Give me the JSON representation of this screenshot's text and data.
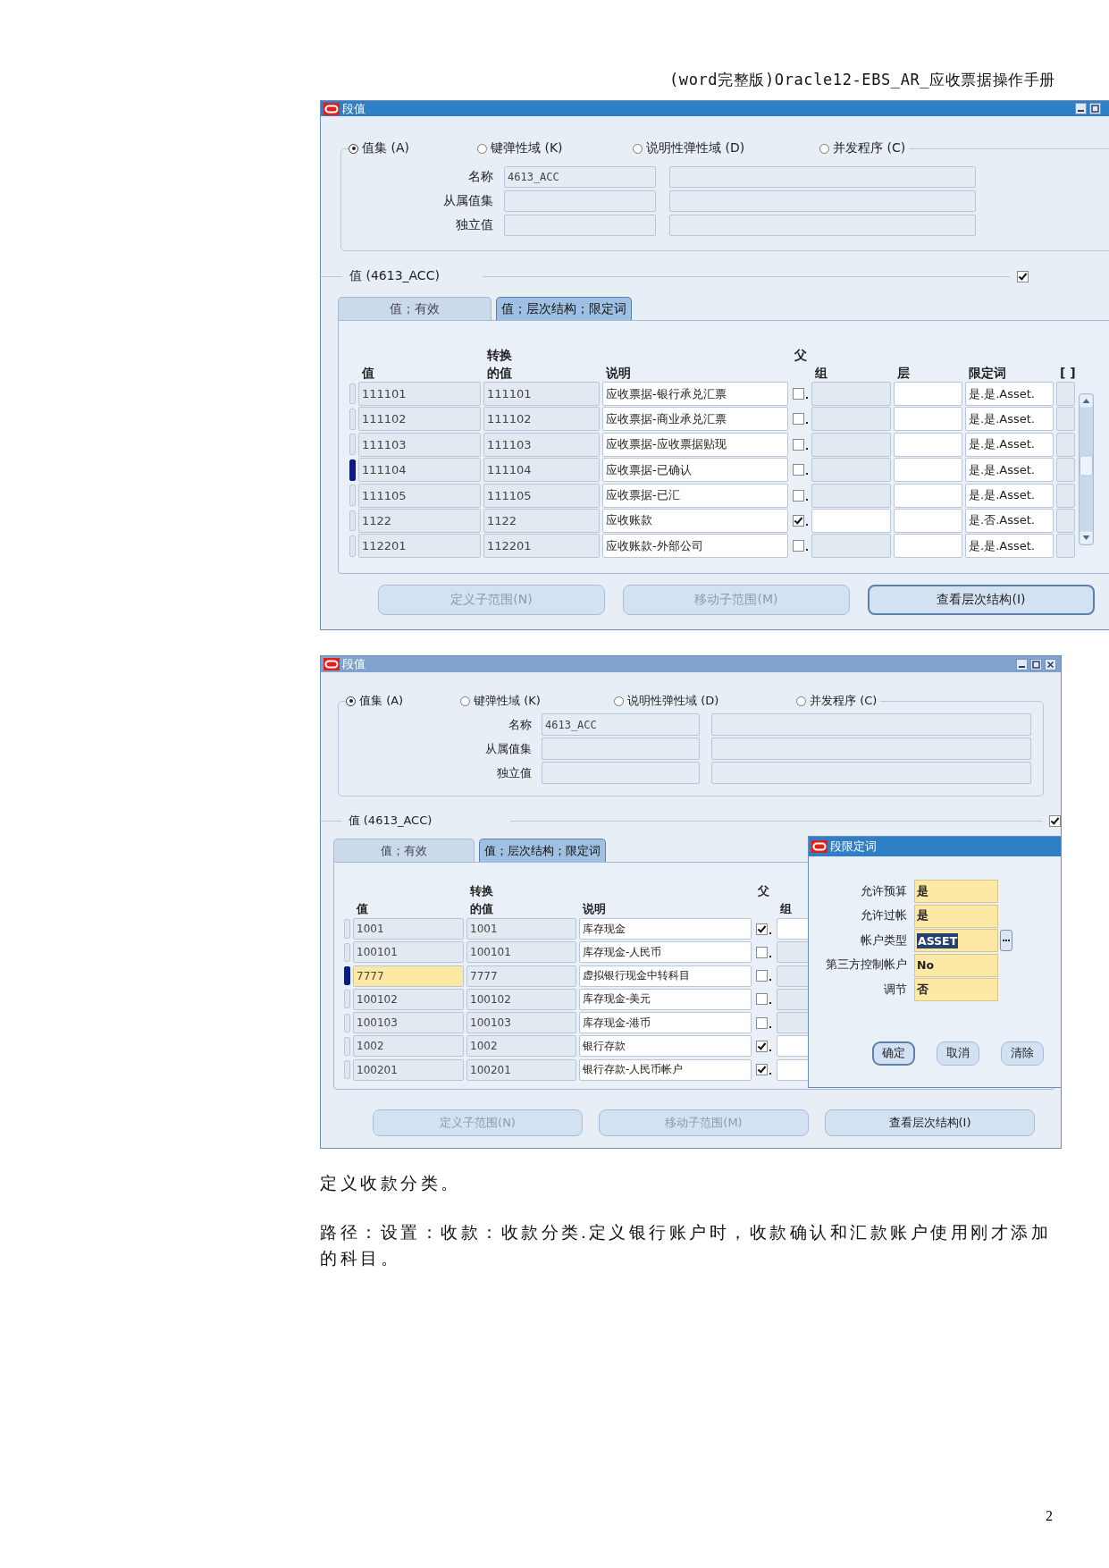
{
  "header": "(word完整版)Oracle12-EBS_AR_应收票据操作手册",
  "windows": [
    {
      "title": "段值",
      "active": true,
      "window_buttons": [
        {
          "kind": "minimize"
        },
        {
          "kind": "maximize"
        }
      ],
      "radios": [
        {
          "label": "值集 (A)",
          "selected": true
        },
        {
          "label": "键弹性域 (K)",
          "selected": false
        },
        {
          "label": "说明性弹性域 (D)",
          "selected": false
        },
        {
          "label": "并发程序 (C)",
          "selected": false
        }
      ],
      "fields": [
        {
          "label": "名称",
          "value": "4613_ACC"
        },
        {
          "label": "从属值集"
        },
        {
          "label": "独立值"
        }
      ],
      "section": {
        "title": "值 (4613_ACC)",
        "checked": true
      },
      "tabs": [
        {
          "label": "值；有效",
          "selected": false
        },
        {
          "label": "值；层次结构；限定词",
          "selected": true
        }
      ],
      "columns": [
        {
          "kind": "value",
          "label": "值"
        },
        {
          "kind": "converted",
          "label_top": "转换",
          "label": "的值"
        },
        {
          "kind": "description",
          "label": "说明"
        },
        {
          "kind": "parent",
          "label_top": "父"
        },
        {
          "kind": "group",
          "label": "组"
        },
        {
          "kind": "level",
          "label": "层"
        },
        {
          "kind": "qualifier",
          "label": "限定词"
        },
        {
          "kind": "extra",
          "label": "[ ]"
        }
      ],
      "scrollbar": true,
      "rows": [
        {
          "value": "111101",
          "converted": "111101",
          "description": "应收票据-银行承兑汇票",
          "parent": false,
          "qualifier": "是.是.Asset.",
          "current": false,
          "focused": false
        },
        {
          "value": "111102",
          "converted": "111102",
          "description": "应收票据-商业承兑汇票",
          "parent": false,
          "qualifier": "是.是.Asset.",
          "current": false,
          "focused": false
        },
        {
          "value": "111103",
          "converted": "111103",
          "description": "应收票据-应收票据贴现",
          "parent": false,
          "qualifier": "是.是.Asset.",
          "current": false,
          "focused": false
        },
        {
          "value": "111104",
          "converted": "111104",
          "description": "应收票据-已确认",
          "parent": false,
          "qualifier": "是.是.Asset.",
          "current": true,
          "focused": false
        },
        {
          "value": "111105",
          "converted": "111105",
          "description": "应收票据-已汇",
          "parent": false,
          "qualifier": "是.是.Asset.",
          "current": false,
          "focused": false
        },
        {
          "value": "1122",
          "converted": "1122",
          "description": "应收账款",
          "parent": true,
          "qualifier": "是.否.Asset.",
          "current": false,
          "focused": false
        },
        {
          "value": "112201",
          "converted": "112201",
          "description": "应收账款-外部公司",
          "parent": false,
          "qualifier": "是.是.Asset.",
          "current": false,
          "focused": false
        }
      ],
      "buttons": [
        {
          "label": "定义子范围(N)",
          "disabled": true
        },
        {
          "label": "移动子范围(M)",
          "disabled": true
        },
        {
          "label": "查看层次结构(I)",
          "disabled": false
        }
      ]
    },
    {
      "title": "段值",
      "active": false,
      "window_buttons": [
        {
          "kind": "minimize"
        },
        {
          "kind": "maximize"
        },
        {
          "kind": "close"
        }
      ],
      "radios": [
        {
          "label": "值集 (A)",
          "selected": true
        },
        {
          "label": "键弹性域 (K)",
          "selected": false
        },
        {
          "label": "说明性弹性域 (D)",
          "selected": false
        },
        {
          "label": "并发程序 (C)",
          "selected": false
        }
      ],
      "fields": [
        {
          "label": "名称",
          "value": "4613_ACC"
        },
        {
          "label": "从属值集"
        },
        {
          "label": "独立值"
        }
      ],
      "section": {
        "title": "值 (4613_ACC)",
        "checked": true
      },
      "tabs": [
        {
          "label": "值；有效",
          "selected": false
        },
        {
          "label": "值；层次结构；限定词",
          "selected": true
        }
      ],
      "columns": [
        {
          "kind": "value",
          "label": "值"
        },
        {
          "kind": "converted",
          "label_top": "转换",
          "label": "的值"
        },
        {
          "kind": "description",
          "label": "说明"
        },
        {
          "kind": "parent",
          "label_top": "父"
        },
        {
          "kind": "group",
          "label": "组"
        }
      ],
      "scrollbar": false,
      "rows": [
        {
          "value": "1001",
          "converted": "1001",
          "description": "库存现金",
          "parent": true,
          "current": false,
          "focused": false
        },
        {
          "value": "100101",
          "converted": "100101",
          "description": "库存现金-人民币",
          "parent": false,
          "current": false,
          "focused": false
        },
        {
          "value": "7777",
          "converted": "7777",
          "description": "虚拟银行现金中转科目",
          "parent": false,
          "current": true,
          "focused": true
        },
        {
          "value": "100102",
          "converted": "100102",
          "description": "库存现金-美元",
          "parent": false,
          "current": false,
          "focused": false
        },
        {
          "value": "100103",
          "converted": "100103",
          "description": "库存现金-港币",
          "parent": false,
          "current": false,
          "focused": false
        },
        {
          "value": "1002",
          "converted": "1002",
          "description": "银行存款",
          "parent": true,
          "current": false,
          "focused": false
        },
        {
          "value": "100201",
          "converted": "100201",
          "description": "银行存款-人民币帐户",
          "parent": true,
          "current": false,
          "focused": false
        }
      ],
      "buttons": [
        {
          "label": "定义子范围(N)",
          "disabled": true
        },
        {
          "label": "移动子范围(M)",
          "disabled": true
        },
        {
          "label": "查看层次结构(I)",
          "disabled": false
        }
      ],
      "popup": {
        "title": "段限定词",
        "fields": [
          {
            "label": "允许预算",
            "value": "是",
            "lov": false,
            "selected": false
          },
          {
            "label": "允许过帐",
            "value": "是",
            "lov": false,
            "selected": false
          },
          {
            "label": "帐户类型",
            "value": "ASSET",
            "lov": true,
            "selected": true
          },
          {
            "label": "第三方控制帐户",
            "value": "No",
            "lov": false,
            "selected": false
          },
          {
            "label": "调节",
            "value": "否",
            "lov": false,
            "selected": false
          }
        ],
        "buttons": [
          {
            "label": "确定",
            "default": true
          },
          {
            "label": "取消",
            "default": false
          },
          {
            "label": "清除",
            "default": false
          }
        ]
      }
    }
  ],
  "paragraphs": [
    "定义收款分类。",
    "路径：设置：收款：收款分类.定义银行账户时，收款确认和汇款账户使用刚才添加的科目。"
  ],
  "page_number": "2"
}
